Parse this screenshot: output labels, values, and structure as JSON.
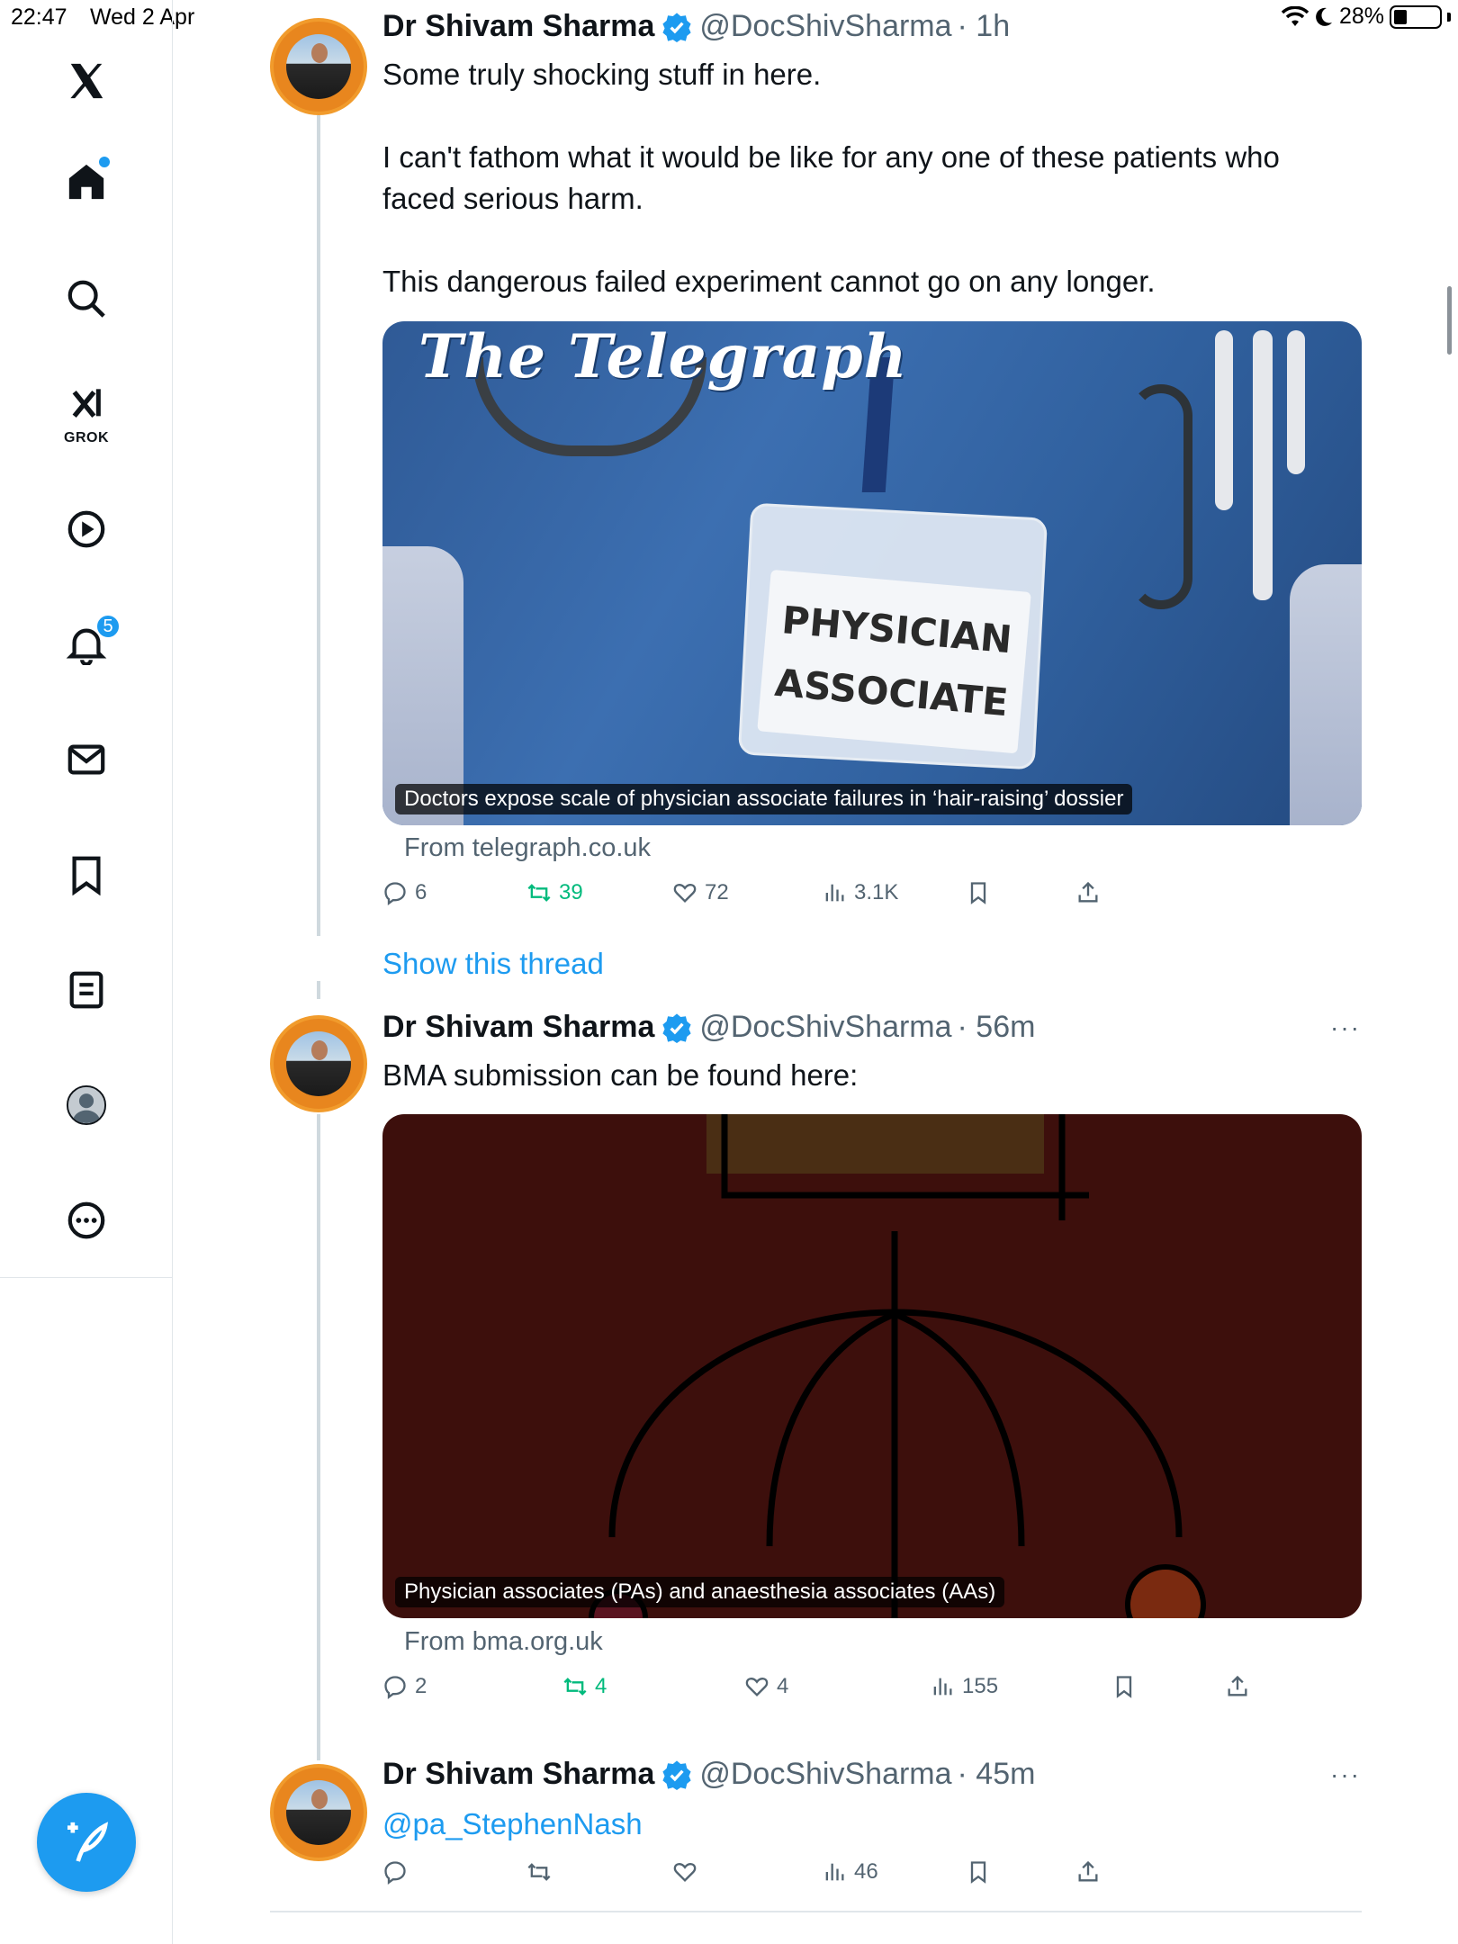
{
  "status_bar": {
    "time": "22:47",
    "date": "Wed 2 Apr",
    "battery": "28%"
  },
  "sidebar": {
    "items": [
      {
        "name": "x-logo"
      },
      {
        "name": "home",
        "has_dot": true
      },
      {
        "name": "search"
      },
      {
        "name": "grok",
        "label": "GROK"
      },
      {
        "name": "video"
      },
      {
        "name": "notifications",
        "badge": "5"
      },
      {
        "name": "messages"
      },
      {
        "name": "bookmarks"
      },
      {
        "name": "lists"
      },
      {
        "name": "profile"
      },
      {
        "name": "more"
      }
    ]
  },
  "tweets": [
    {
      "author": "Dr Shivam Sharma",
      "handle": "@DocShivSharma",
      "time": "· 1h",
      "text_lines": [
        "Some truly shocking stuff in here.",
        "",
        "I can't fathom what it would be like for any one of these patients who",
        "faced serious harm.",
        "",
        "This dangerous failed experiment cannot go on any longer."
      ],
      "card": {
        "logo": "The Telegraph",
        "badge_line1": "PHYSICIAN",
        "badge_line2": "ASSOCIATE",
        "caption": "Doctors expose scale of physician associate failures in ‘hair-raising’ dossier",
        "from": "From telegraph.co.uk"
      },
      "actions": {
        "replies": "6",
        "reposts": "39",
        "likes": "72",
        "views": "3.1K"
      }
    },
    {
      "author": "Dr Shivam Sharma",
      "handle": "@DocShivSharma",
      "time": "· 56m",
      "text_lines": [
        "BMA submission can be found here:"
      ],
      "card": {
        "caption": "Physician associates (PAs) and anaesthesia associates (AAs)",
        "from": "From bma.org.uk"
      },
      "actions": {
        "replies": "2",
        "reposts": "4",
        "likes": "4",
        "views": "155"
      }
    },
    {
      "author": "Dr Shivam Sharma",
      "handle": "@DocShivSharma",
      "time": "· 45m",
      "mention": "@pa_StephenNash",
      "actions": {
        "replies": "",
        "reposts": "",
        "likes": "",
        "views": "46"
      }
    }
  ],
  "show_thread": "Show this thread",
  "more_menu": "···",
  "colors": {
    "accent": "#1d9bf0",
    "repost": "#00ba7c",
    "muted": "#536471",
    "avatar_ring": "#e8861e"
  }
}
